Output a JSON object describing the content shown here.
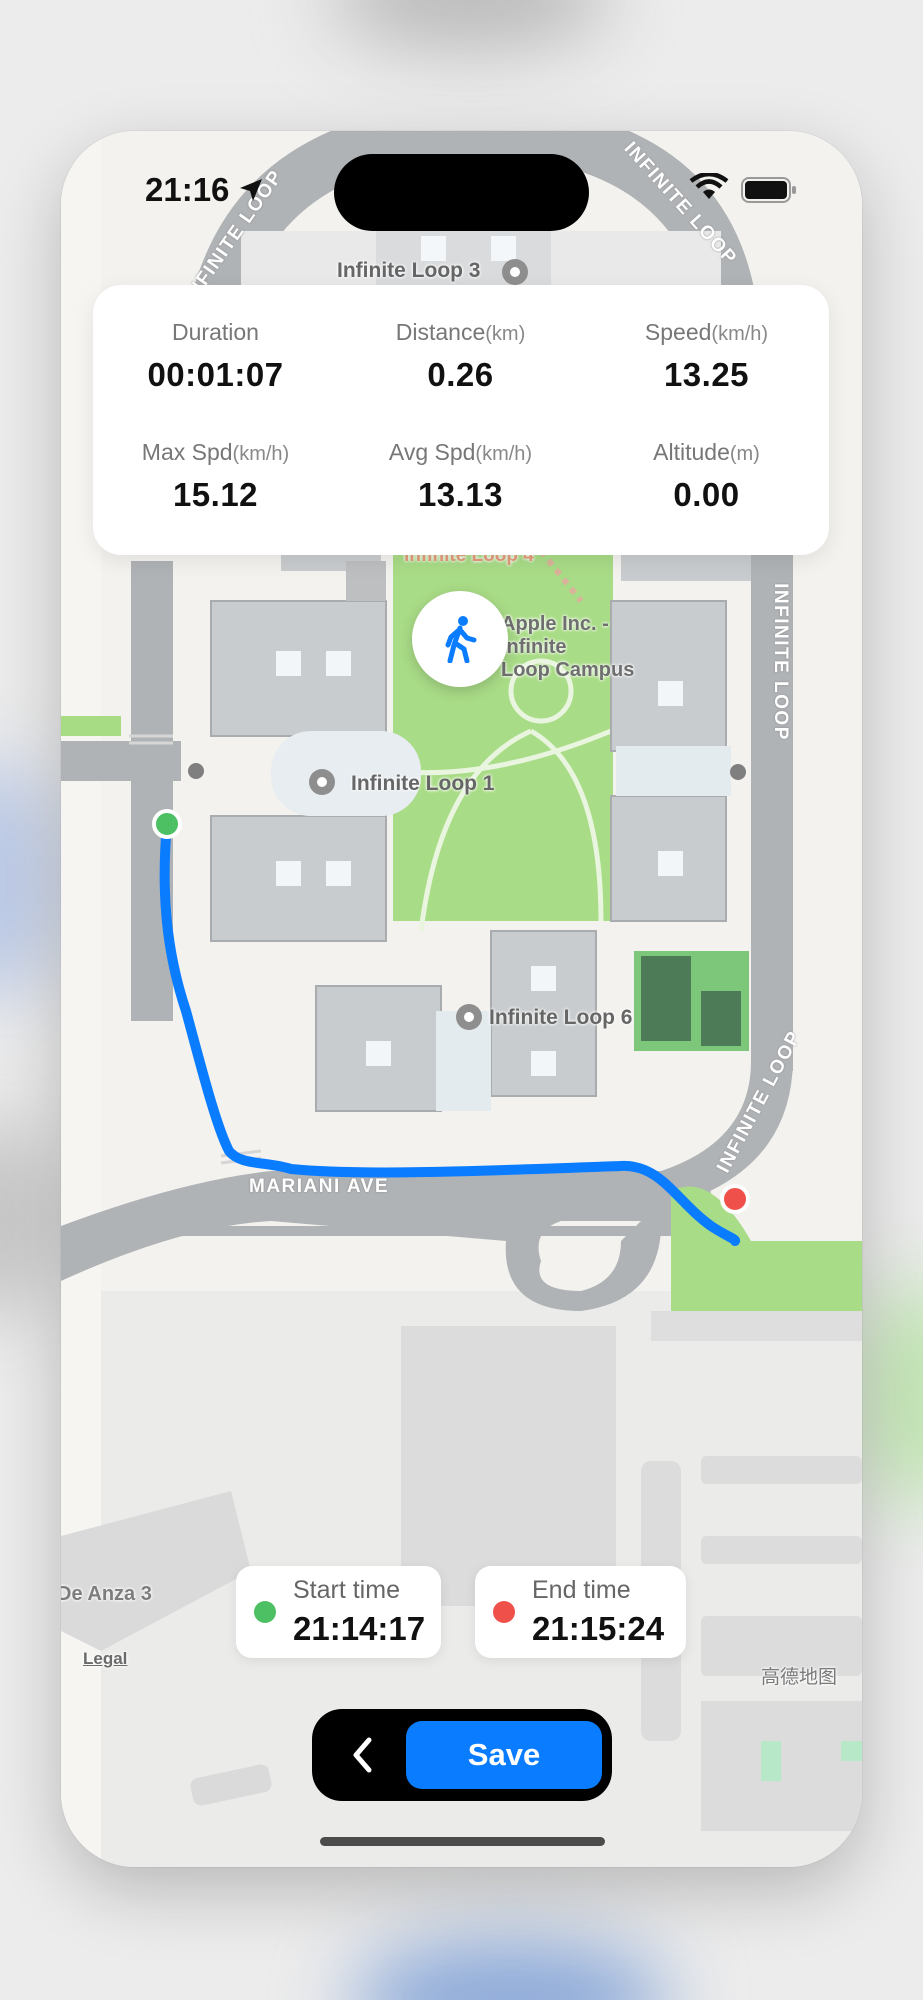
{
  "status_bar": {
    "time": "21:16"
  },
  "stats": [
    {
      "label": "Duration",
      "unit": "",
      "value": "00:01:07"
    },
    {
      "label": "Distance",
      "unit": "(km)",
      "value": "0.26"
    },
    {
      "label": "Speed",
      "unit": "(km/h)",
      "value": "13.25"
    },
    {
      "label": "Max Spd",
      "unit": "(km/h)",
      "value": "15.12"
    },
    {
      "label": "Avg Spd",
      "unit": "(km/h)",
      "value": "13.13"
    },
    {
      "label": "Altitude",
      "unit": "(m)",
      "value": "0.00"
    }
  ],
  "map": {
    "labels": {
      "infinite_loop_3": "Infinite Loop 3",
      "infinite_loop_1": "Infinite Loop 1",
      "infinite_loop_6": "Infinite Loop 6",
      "apple_campus_line1": "Apple Inc. -",
      "apple_campus_line2": "Infinite",
      "apple_campus_line3": "Loop Campus",
      "infinite_loop_top_partial": "Infinite Loop 4",
      "de_anza_3": "De Anza 3",
      "legal": "Legal",
      "provider": "高德地图"
    },
    "streets": {
      "infinite_loop_tl": "INFINITE LOOP",
      "infinite_loop_tr": "INFINITE LOOP",
      "infinite_loop_right": "INFINITE LOOP",
      "infinite_loop_br": "INFINITE LOOP",
      "mariani_ave": "MARIANI AVE"
    },
    "route_color": "#0a7cff",
    "start_marker_color": "#3fbf5f",
    "end_marker_color": "#f0504a"
  },
  "mode_icon": "walking-person-icon",
  "times": {
    "start": {
      "label": "Start time",
      "value": "21:14:17"
    },
    "end": {
      "label": "End time",
      "value": "21:15:24"
    }
  },
  "actions": {
    "save_label": "Save",
    "back_icon": "chevron-left-icon"
  }
}
